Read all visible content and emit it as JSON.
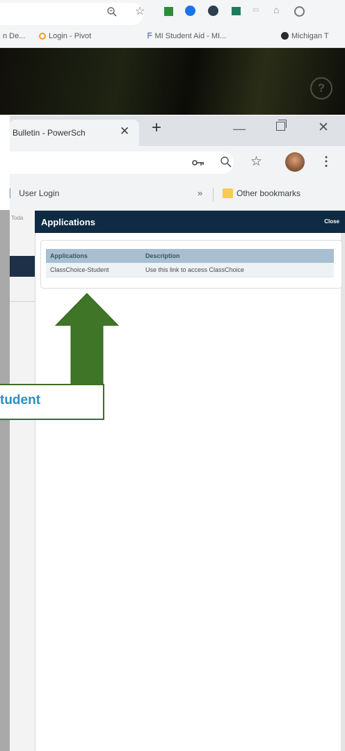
{
  "outer_browser": {
    "bookmarks": [
      "n De...",
      "Login - Pivot",
      "MI Student Aid - MI...",
      "Michigan T"
    ]
  },
  "inner_browser": {
    "tab": {
      "title": "Bulletin - PowerSch",
      "close": "✕"
    },
    "new_tab": "+",
    "window_controls": {
      "minimize": "—",
      "close": "✕"
    },
    "bookmarks": {
      "user_login": "User Login",
      "overflow": "»",
      "other": "Other bookmarks"
    }
  },
  "page": {
    "left_tab_fragment": "Toda"
  },
  "dialog": {
    "title": "Applications",
    "close_label": "Close",
    "table": {
      "headers": [
        "Applications",
        "Description"
      ],
      "rows": [
        {
          "application": "ClassChoice-Student",
          "description": "Use this link to access ClassChoice"
        }
      ]
    }
  },
  "annotation": {
    "label": "tudent",
    "arrow_color": "#3e7526"
  },
  "colors": {
    "dialog_header": "#0e2b43",
    "table_header": "#a7bfd0",
    "link": "#4b7bb5",
    "annotation_text": "#2f8cbf"
  }
}
